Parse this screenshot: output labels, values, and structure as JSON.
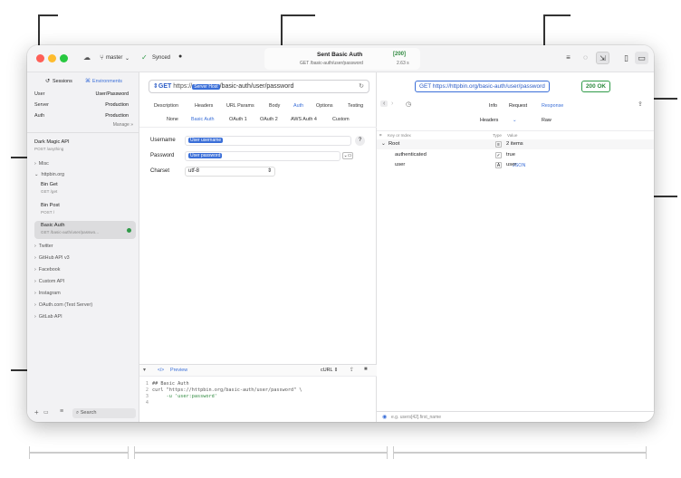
{
  "titlebar": {
    "branch": "master",
    "sync_status": "Synced",
    "request_title": "Sent Basic Auth",
    "request_subtitle": "GET /basic-auth/user/password",
    "status_code": "200",
    "duration": "2.63 s"
  },
  "sidebar": {
    "tabs": {
      "sessions": "Sessions",
      "environments": "Environments"
    },
    "env_rows": [
      {
        "key": "User",
        "value": "User/Password"
      },
      {
        "key": "Server",
        "value": "Production"
      },
      {
        "key": "Auth",
        "value": "Production"
      }
    ],
    "manage_label": "Manage",
    "top_item": {
      "title": "Dark Magic API",
      "sub": "POST /anything"
    },
    "groups_before": [
      "Misc"
    ],
    "open_group": "httpbin.org",
    "requests": [
      {
        "title": "Bin Get",
        "sub": "GET /get"
      },
      {
        "title": "Bin Post",
        "sub": "POST /"
      },
      {
        "title": "Basic Auth",
        "sub": "GET /basic-auth/user/passwo..."
      }
    ],
    "groups_after": [
      "Twitter",
      "GitHub API v3",
      "Facebook",
      "Custom API",
      "Instagram",
      "OAuth.com (Test Server)",
      "GitLab API"
    ],
    "search_placeholder": "Search"
  },
  "center": {
    "method": "GET",
    "url_prefix": "https://",
    "url_token": "Server Host",
    "url_path": "/basic-auth/user/password",
    "tabs": [
      "Description",
      "Headers",
      "URL Params",
      "Body",
      "Auth",
      "Options",
      "Testing"
    ],
    "active_tab": "Auth",
    "auth_tabs": [
      "None",
      "Basic Auth",
      "OAuth 1",
      "OAuth 2",
      "AWS Auth 4",
      "Custom"
    ],
    "active_auth_tab": "Basic Auth",
    "form": {
      "username_label": "Username",
      "username_token": "User username",
      "password_label": "Password",
      "password_token": "User password",
      "charset_label": "Charset",
      "charset_value": "utf-8"
    },
    "editor": {
      "preview_label": "Preview",
      "language": "cURL",
      "lines": [
        {
          "n": "1",
          "text": "## Basic Auth"
        },
        {
          "n": "2",
          "text": "curl \"https://httpbin.org/basic-auth/user/password\" \\"
        },
        {
          "n": "3",
          "text": "     -u 'user:password'"
        },
        {
          "n": "4",
          "text": ""
        }
      ]
    }
  },
  "response": {
    "url": "GET https://httpbin.org/basic-auth/user/password",
    "status": "200 OK",
    "nav_tabs": [
      "Info",
      "Request",
      "Response"
    ],
    "active_nav_tab": "Response",
    "body_tabs": [
      "Headers",
      "JSON",
      "Raw"
    ],
    "active_body_tab": "JSON",
    "tree_headers": {
      "key": "Key or Index",
      "type": "Type",
      "value": "Value"
    },
    "tree": [
      {
        "key": "Root",
        "type_icon": "≡",
        "value": "2 items",
        "indent": 0
      },
      {
        "key": "authenticated",
        "type_icon": "✓",
        "value": "true",
        "indent": 1
      },
      {
        "key": "user",
        "type_icon": "A",
        "value": "user",
        "indent": 1
      }
    ],
    "filter_placeholder": "e.g. users[42].first_name"
  },
  "colors": {
    "accent": "#3b6fd8",
    "success": "#2f9a48"
  }
}
